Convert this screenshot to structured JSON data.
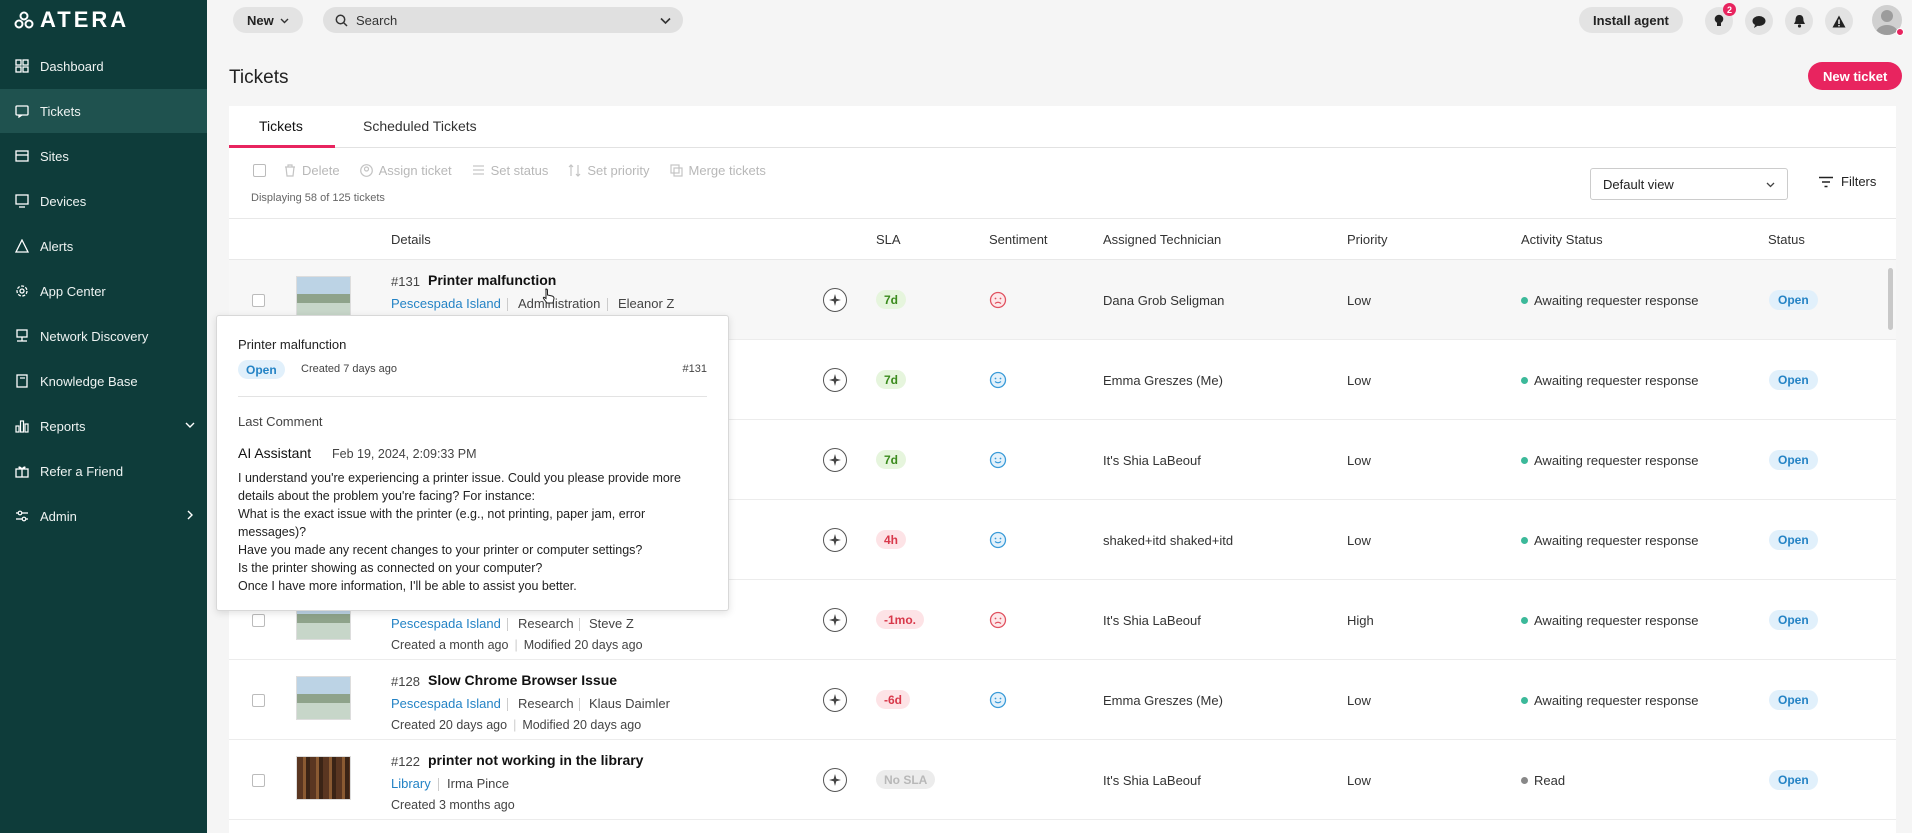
{
  "app": {
    "logo_text": "ATERA"
  },
  "sidebar": {
    "items": [
      {
        "label": "Dashboard",
        "icon": "dashboard-icon"
      },
      {
        "label": "Tickets",
        "icon": "ticket-icon"
      },
      {
        "label": "Sites",
        "icon": "sites-icon"
      },
      {
        "label": "Devices",
        "icon": "monitor-icon"
      },
      {
        "label": "Alerts",
        "icon": "warning-icon"
      },
      {
        "label": "App Center",
        "icon": "gear-icon"
      },
      {
        "label": "Network Discovery",
        "icon": "network-icon"
      },
      {
        "label": "Knowledge Base",
        "icon": "book-icon"
      },
      {
        "label": "Reports",
        "icon": "chart-icon"
      },
      {
        "label": "Refer a Friend",
        "icon": "gift-icon"
      },
      {
        "label": "Admin",
        "icon": "sliders-icon"
      }
    ]
  },
  "topbar": {
    "new_label": "New",
    "search_placeholder": "Search",
    "install_label": "Install agent",
    "notifications_badge": "2"
  },
  "page": {
    "title": "Tickets",
    "new_ticket_label": "New ticket",
    "tabs": [
      "Tickets",
      "Scheduled Tickets"
    ],
    "toolbar": {
      "delete": "Delete",
      "assign": "Assign ticket",
      "set_status": "Set status",
      "set_priority": "Set priority",
      "merge": "Merge tickets"
    },
    "displaying": "Displaying 58 of 125 tickets",
    "view_select": "Default view",
    "filters": "Filters",
    "columns": {
      "details": "Details",
      "sla": "SLA",
      "sentiment": "Sentiment",
      "technician": "Assigned Technician",
      "priority": "Priority",
      "activity": "Activity Status",
      "status": "Status"
    }
  },
  "tickets": [
    {
      "num": "#131",
      "title": "Printer malfunction",
      "site": "Pescespada Island",
      "dept": "Administration",
      "requester": "Eleanor Z",
      "created": "",
      "modified": "",
      "sla": "7d",
      "sla_tone": "green",
      "sentiment": "negative",
      "technician": "Dana Grob Seligman",
      "priority": "Low",
      "activity": "Awaiting requester response",
      "status": "Open"
    },
    {
      "num": "",
      "title": "",
      "site": "",
      "dept": "",
      "requester": "",
      "created": "",
      "modified": "",
      "sla": "7d",
      "sla_tone": "green",
      "sentiment": "positive",
      "technician": "Emma Greszes (Me)",
      "priority": "Low",
      "activity": "Awaiting requester response",
      "status": "Open"
    },
    {
      "num": "",
      "title": "",
      "site": "",
      "dept": "",
      "requester": "",
      "created": "",
      "modified": "",
      "sla": "7d",
      "sla_tone": "green",
      "sentiment": "positive",
      "technician": "It's Shia LaBeouf",
      "priority": "Low",
      "activity": "Awaiting requester response",
      "status": "Open"
    },
    {
      "num": "",
      "title": "",
      "site": "",
      "dept": "",
      "requester": "",
      "created": "",
      "modified": "",
      "sla": "4h",
      "sla_tone": "red",
      "sentiment": "positive",
      "technician": "shaked+itd shaked+itd",
      "priority": "Low",
      "activity": "Awaiting requester response",
      "status": "Open"
    },
    {
      "num": "",
      "title": "",
      "site": "Pescespada Island",
      "dept": "Research",
      "requester": "Steve Z",
      "created": "Created a month ago",
      "modified": "Modified 20 days ago",
      "sla": "-1mo.",
      "sla_tone": "red",
      "sentiment": "negative",
      "technician": "It's Shia LaBeouf",
      "priority": "High",
      "activity": "Awaiting requester response",
      "status": "Open"
    },
    {
      "num": "#128",
      "title": "Slow Chrome Browser Issue",
      "site": "Pescespada Island",
      "dept": "Research",
      "requester": "Klaus Daimler",
      "created": "Created 20 days ago",
      "modified": "Modified 20 days ago",
      "sla": "-6d",
      "sla_tone": "red",
      "sentiment": "positive",
      "technician": "Emma Greszes (Me)",
      "priority": "Low",
      "activity": "Awaiting requester response",
      "status": "Open"
    },
    {
      "num": "#122",
      "title": "printer not working in the library",
      "site": "Library",
      "dept": "",
      "requester": "Irma Pince",
      "created": "Created 3 months ago",
      "modified": "",
      "sla": "No SLA",
      "sla_tone": "grey",
      "sentiment": "none",
      "technician": "It's Shia LaBeouf",
      "priority": "Low",
      "activity": "Read",
      "status": "Open"
    }
  ],
  "popup": {
    "title": "Printer malfunction",
    "status": "Open",
    "created": "Created 7 days ago",
    "num": "#131",
    "last_comment_label": "Last Comment",
    "author": "AI Assistant",
    "date": "Feb 19, 2024, 2:09:33 PM",
    "lines": [
      "I understand you're experiencing a printer issue. Could you please provide more",
      "details about the problem you're facing? For instance:",
      "What is the exact issue with the printer (e.g., not printing, paper jam, error",
      "messages)?",
      "Have you made any recent changes to your printer or computer settings?",
      "Is the printer showing as connected on your computer?",
      "Once I have more information, I'll be able to assist you better."
    ]
  },
  "colors": {
    "sidebar": "#0e3c3a",
    "accent": "#e8245f",
    "link": "#2483c5"
  }
}
